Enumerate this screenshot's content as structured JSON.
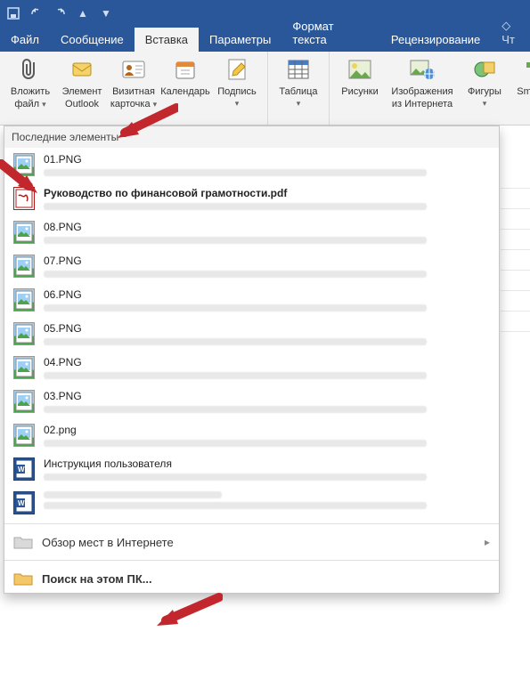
{
  "title_bar": {
    "icons": [
      "save",
      "undo",
      "redo",
      "up",
      "down"
    ]
  },
  "tabs": [
    {
      "label": "Файл",
      "kind": "file"
    },
    {
      "label": "Сообщение"
    },
    {
      "label": "Вставка",
      "active": true
    },
    {
      "label": "Параметры"
    },
    {
      "label": "Формат текста"
    },
    {
      "label": "Рецензирование"
    },
    {
      "label": "Чт",
      "faded": true
    }
  ],
  "ribbon": {
    "attach": {
      "l1": "Вложить",
      "l2": "файл"
    },
    "outlook": {
      "l1": "Элемент",
      "l2": "Outlook"
    },
    "bizcard": {
      "l1": "Визитная",
      "l2": "карточка"
    },
    "calendar": {
      "l1": "Календарь"
    },
    "signature": {
      "l1": "Подпись"
    },
    "table": {
      "l1": "Таблица"
    },
    "pictures": {
      "l1": "Рисунки"
    },
    "webimg": {
      "l1": "Изображения",
      "l2": "из Интернета"
    },
    "shapes": {
      "l1": "Фигуры"
    },
    "smartart": {
      "l1": "SmartArt"
    }
  },
  "dropdown": {
    "header": "Последние элементы",
    "items": [
      {
        "name": "01.PNG",
        "type": "img"
      },
      {
        "name": "Руководство по финансовой грамотности.pdf",
        "type": "pdf",
        "bold": true
      },
      {
        "name": "08.PNG",
        "type": "img"
      },
      {
        "name": "07.PNG",
        "type": "img"
      },
      {
        "name": "06.PNG",
        "type": "img"
      },
      {
        "name": "05.PNG",
        "type": "img"
      },
      {
        "name": "04.PNG",
        "type": "img"
      },
      {
        "name": "03.PNG",
        "type": "img"
      },
      {
        "name": "02.png",
        "type": "img"
      },
      {
        "name": "Инструкция пользователя",
        "type": "doc"
      },
      {
        "name": "",
        "type": "doc",
        "placeholder": true
      }
    ],
    "browse_web": "Обзор мест в Интернете",
    "browse_pc": "Поиск на этом ПК..."
  },
  "caret": "▾"
}
